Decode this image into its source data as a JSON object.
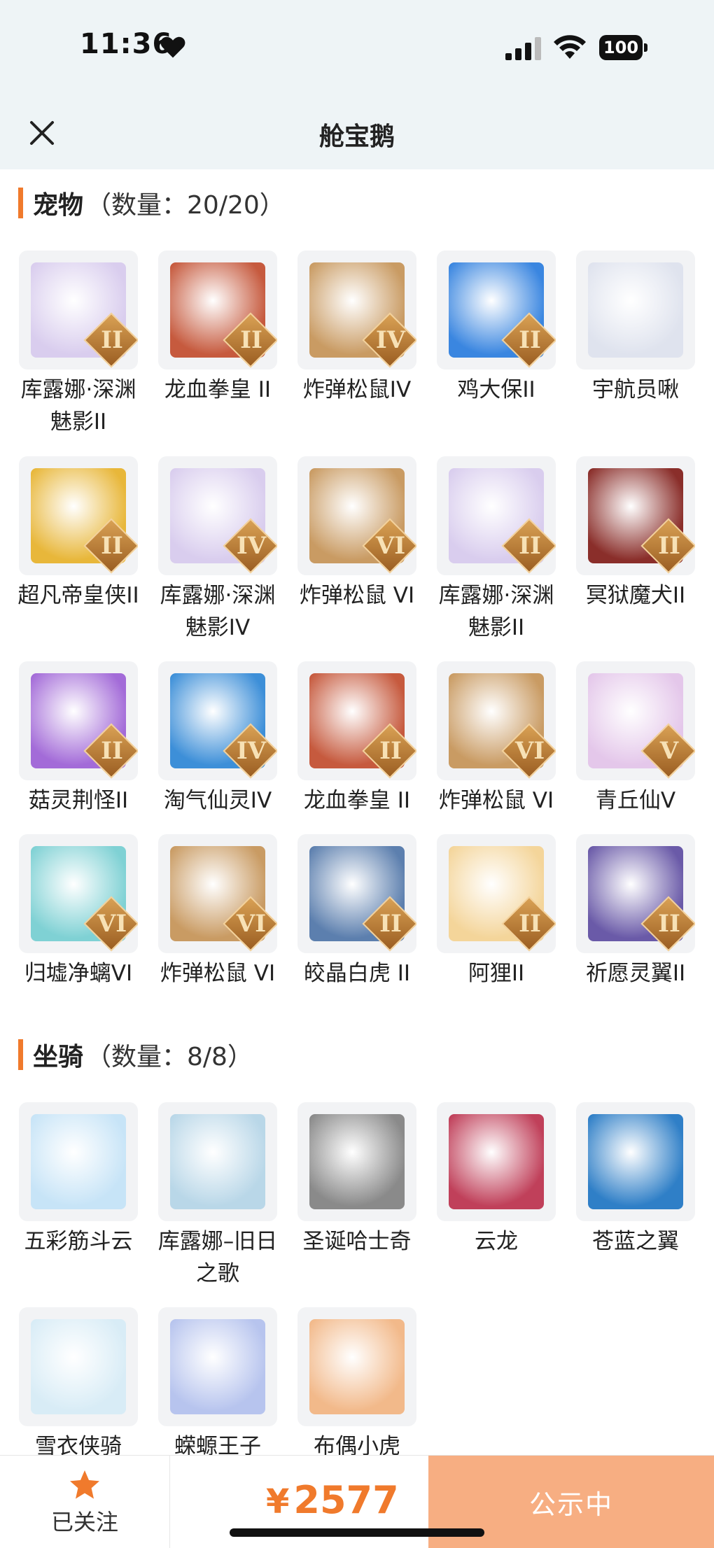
{
  "status_bar": {
    "time": "11:36",
    "battery": "100"
  },
  "header": {
    "title": "舱宝鹅"
  },
  "pets": {
    "label": "宠物",
    "count": "（数量：20/20）",
    "items": [
      {
        "name": "库露娜·深渊魅影II",
        "tier": "II",
        "color": "#d9cdee"
      },
      {
        "name": "龙血拳皇 II",
        "tier": "II",
        "color": "#c65a3e"
      },
      {
        "name": "炸弹松鼠IV",
        "tier": "IV",
        "color": "#c99b63"
      },
      {
        "name": "鸡大保II",
        "tier": "II",
        "color": "#3a86e0"
      },
      {
        "name": "宇航员啾",
        "tier": "",
        "color": "#dfe3ee"
      },
      {
        "name": "超凡帝皇侠II",
        "tier": "II",
        "color": "#e8b73a"
      },
      {
        "name": "库露娜·深渊魅影IV",
        "tier": "IV",
        "color": "#d9cdee"
      },
      {
        "name": "炸弹松鼠 VI",
        "tier": "VI",
        "color": "#c99b63"
      },
      {
        "name": "库露娜·深渊魅影II",
        "tier": "II",
        "color": "#d9cdee"
      },
      {
        "name": "冥狱魔犬II",
        "tier": "II",
        "color": "#8a2e2a"
      },
      {
        "name": "菇灵荆怪II",
        "tier": "II",
        "color": "#a36bd8"
      },
      {
        "name": "淘气仙灵IV",
        "tier": "IV",
        "color": "#3d8fd8"
      },
      {
        "name": "龙血拳皇 II",
        "tier": "II",
        "color": "#c65a3e"
      },
      {
        "name": "炸弹松鼠 VI",
        "tier": "VI",
        "color": "#c99b63"
      },
      {
        "name": "青丘仙V",
        "tier": "V",
        "color": "#e4c7ea"
      },
      {
        "name": "归墟净螭VI",
        "tier": "VI",
        "color": "#7fd1d4"
      },
      {
        "name": "炸弹松鼠 VI",
        "tier": "VI",
        "color": "#c99b63"
      },
      {
        "name": "皎晶白虎 II",
        "tier": "II",
        "color": "#5c7fae"
      },
      {
        "name": "阿狸II",
        "tier": "II",
        "color": "#f4d59a"
      },
      {
        "name": "祈愿灵翼II",
        "tier": "II",
        "color": "#6a5aa8"
      }
    ]
  },
  "mounts": {
    "label": "坐骑",
    "count": "（数量：8/8）",
    "items": [
      {
        "name": "五彩筋斗云",
        "tier": "",
        "color": "#c7e4f7"
      },
      {
        "name": "库露娜–旧日之歌",
        "tier": "",
        "color": "#b9d7e8"
      },
      {
        "name": "圣诞哈士奇",
        "tier": "",
        "color": "#8a8a8a"
      },
      {
        "name": "云龙",
        "tier": "",
        "color": "#c0405a"
      },
      {
        "name": "苍蓝之翼",
        "tier": "",
        "color": "#2f7fc7"
      },
      {
        "name": "雪衣侠骑",
        "tier": "",
        "color": "#d8ecf6"
      },
      {
        "name": "蝾螈王子",
        "tier": "",
        "color": "#b7c4ee"
      },
      {
        "name": "布偶小虎",
        "tier": "",
        "color": "#f2b98a"
      }
    ]
  },
  "bottom": {
    "follow_label": "已关注",
    "currency": "¥",
    "price": "2577",
    "cta": "公示中"
  }
}
